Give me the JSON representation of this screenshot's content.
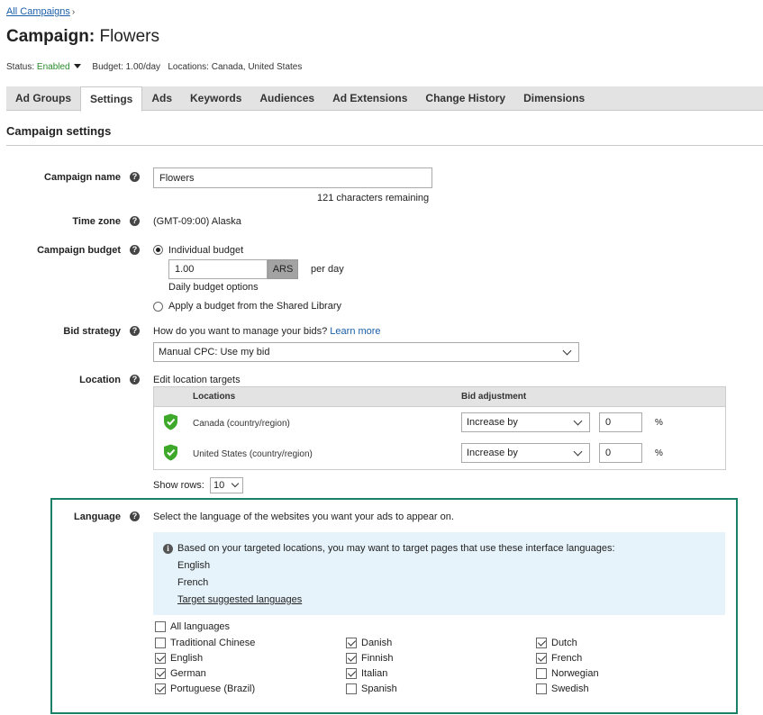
{
  "breadcrumb": {
    "label": "All Campaigns",
    "chevron": "›"
  },
  "header": {
    "prefix": "Campaign:",
    "name": "Flowers"
  },
  "status_line": {
    "status_label": "Status:",
    "status_value": "Enabled",
    "budget": "Budget: 1.00/day",
    "locations": "Locations: Canada, United States"
  },
  "tabs": [
    {
      "label": "Ad Groups",
      "active": false
    },
    {
      "label": "Settings",
      "active": true
    },
    {
      "label": "Ads",
      "active": false
    },
    {
      "label": "Keywords",
      "active": false
    },
    {
      "label": "Audiences",
      "active": false
    },
    {
      "label": "Ad Extensions",
      "active": false
    },
    {
      "label": "Change History",
      "active": false
    },
    {
      "label": "Dimensions",
      "active": false
    }
  ],
  "section_title": "Campaign settings",
  "campaign_name": {
    "label": "Campaign name",
    "value": "Flowers",
    "remaining": "121 characters remaining"
  },
  "time_zone": {
    "label": "Time zone",
    "value": "(GMT-09:00) Alaska"
  },
  "budget": {
    "label": "Campaign budget",
    "individual_label": "Individual budget",
    "amount": "1.00",
    "currency": "ARS",
    "per_day": "per day",
    "options_link": "Daily budget options",
    "shared_label": "Apply a budget from the Shared Library"
  },
  "bid_strategy": {
    "label": "Bid strategy",
    "prompt": "How do you want to manage your bids?",
    "learn_more": "Learn more",
    "selected": "Manual CPC: Use my bid"
  },
  "location": {
    "label": "Location",
    "edit_link": "Edit location targets",
    "col_locations": "Locations",
    "col_bid": "Bid adjustment",
    "rows": [
      {
        "name": "Canada (country/region)",
        "adjust": "Increase by",
        "value": "0",
        "unit": "%"
      },
      {
        "name": "United States (country/region)",
        "adjust": "Increase by",
        "value": "0",
        "unit": "%"
      }
    ],
    "show_rows_label": "Show rows:",
    "show_rows_value": "10"
  },
  "language": {
    "label": "Language",
    "description": "Select the language of the websites you want your ads to appear on.",
    "info_text": "Based on your targeted locations, you may want to target pages that use these interface languages:",
    "suggested": [
      "English",
      "French"
    ],
    "target_link": "Target suggested languages",
    "all_languages": {
      "label": "All languages",
      "checked": false
    },
    "columns": [
      [
        {
          "label": "Traditional Chinese",
          "checked": false
        },
        {
          "label": "English",
          "checked": true
        },
        {
          "label": "German",
          "checked": true
        },
        {
          "label": "Portuguese (Brazil)",
          "checked": true
        }
      ],
      [
        {
          "label": "Danish",
          "checked": true
        },
        {
          "label": "Finnish",
          "checked": true
        },
        {
          "label": "Italian",
          "checked": true
        },
        {
          "label": "Spanish",
          "checked": false
        }
      ],
      [
        {
          "label": "Dutch",
          "checked": true
        },
        {
          "label": "French",
          "checked": true
        },
        {
          "label": "Norwegian",
          "checked": false
        },
        {
          "label": "Swedish",
          "checked": false
        }
      ]
    ]
  },
  "colors": {
    "accent_green": "#1a8068",
    "link": "#1a5fa8",
    "enabled": "#2a8a2a",
    "shield": "#3ea82a"
  }
}
